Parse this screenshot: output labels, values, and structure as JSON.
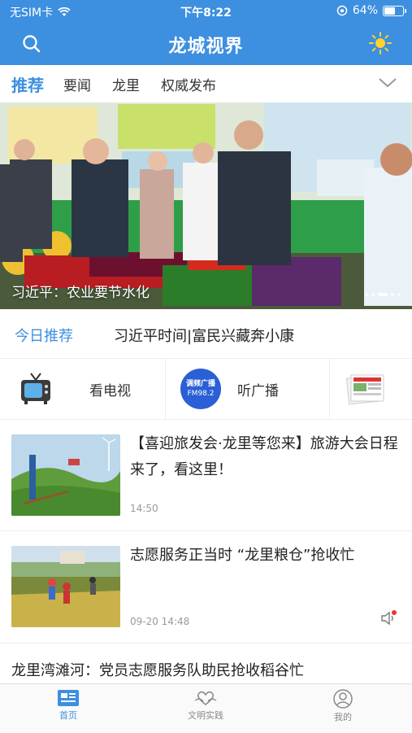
{
  "status_bar": {
    "carrier": "无SIM卡",
    "time": "下午8:22",
    "battery": "64%",
    "battery_level": 0.64
  },
  "nav": {
    "title": "龙城视界",
    "search_icon": "search-icon",
    "theme_icon": "sun-icon"
  },
  "tabs": [
    {
      "label": "推荐",
      "active": true
    },
    {
      "label": "要闻"
    },
    {
      "label": "龙里"
    },
    {
      "label": "权威发布"
    }
  ],
  "banner": {
    "caption": "习近平：农业要节水化",
    "slides": 5,
    "current": 2
  },
  "today": {
    "label": "今日推荐",
    "headline": "习近平时间|富民兴藏奔小康"
  },
  "channels": [
    {
      "label": "看电视",
      "icon": "tv-icon"
    },
    {
      "label": "听广播",
      "icon": "radio-fm-icon",
      "badge_text": "调频广播",
      "badge_freq": "FM98.2"
    },
    {
      "label": "",
      "icon": "newspaper-icon"
    }
  ],
  "news": [
    {
      "title": "【喜迎旅发会·龙里等您来】旅游大会日程来了，看这里！",
      "time": "14:50"
    },
    {
      "title": "志愿服务正当时 “龙里粮仓”抢收忙",
      "time": "09-20 14:48"
    }
  ],
  "bottom_news": {
    "title": "龙里湾滩河：党员志愿服务队助民抢收稻谷忙"
  },
  "tabbar": [
    {
      "label": "首页",
      "active": true
    },
    {
      "label": "文明实践"
    },
    {
      "label": "我的"
    }
  ],
  "colors": {
    "primary": "#3d8fe0",
    "text": "#222222",
    "muted": "#999999"
  }
}
